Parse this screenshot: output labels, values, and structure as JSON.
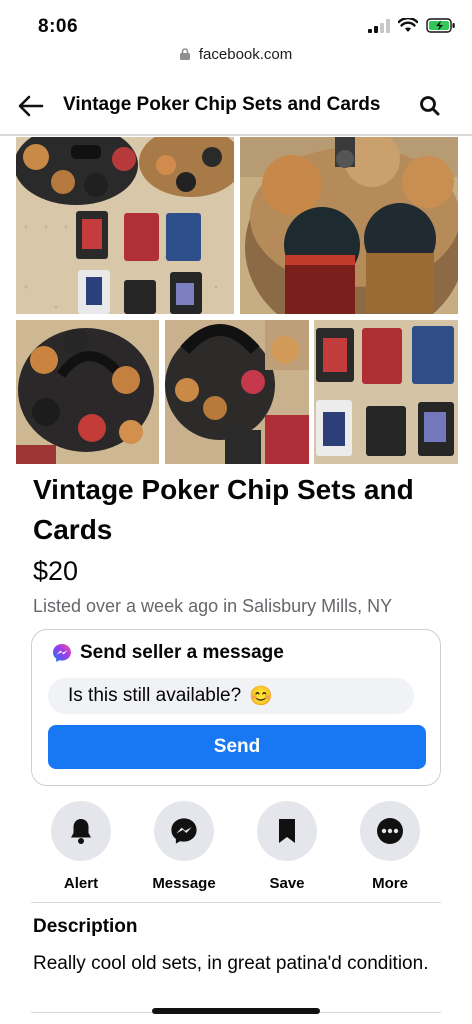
{
  "status": {
    "time": "8:06"
  },
  "browser": {
    "url": "facebook.com"
  },
  "header": {
    "title": "Vintage Poker Chip Sets and Cards"
  },
  "listing": {
    "title": "Vintage Poker Chip Sets and Cards",
    "price": "$20",
    "listed": "Listed over a week ago in Salisbury Mills, NY"
  },
  "message": {
    "heading": "Send seller a message",
    "input_value": "Is this still available?",
    "emoji": "😊",
    "send_label": "Send"
  },
  "actions": [
    {
      "label": "Alert",
      "icon": "bell-icon"
    },
    {
      "label": "Message",
      "icon": "messenger-icon"
    },
    {
      "label": "Save",
      "icon": "bookmark-icon"
    },
    {
      "label": "More",
      "icon": "more-icon"
    }
  ],
  "description": {
    "heading": "Description",
    "text": "Really cool old sets, in great patina'd condition."
  },
  "colors": {
    "accent": "#1877f2",
    "secondary_bg": "#e4e6eb",
    "muted_text": "#65676b"
  }
}
